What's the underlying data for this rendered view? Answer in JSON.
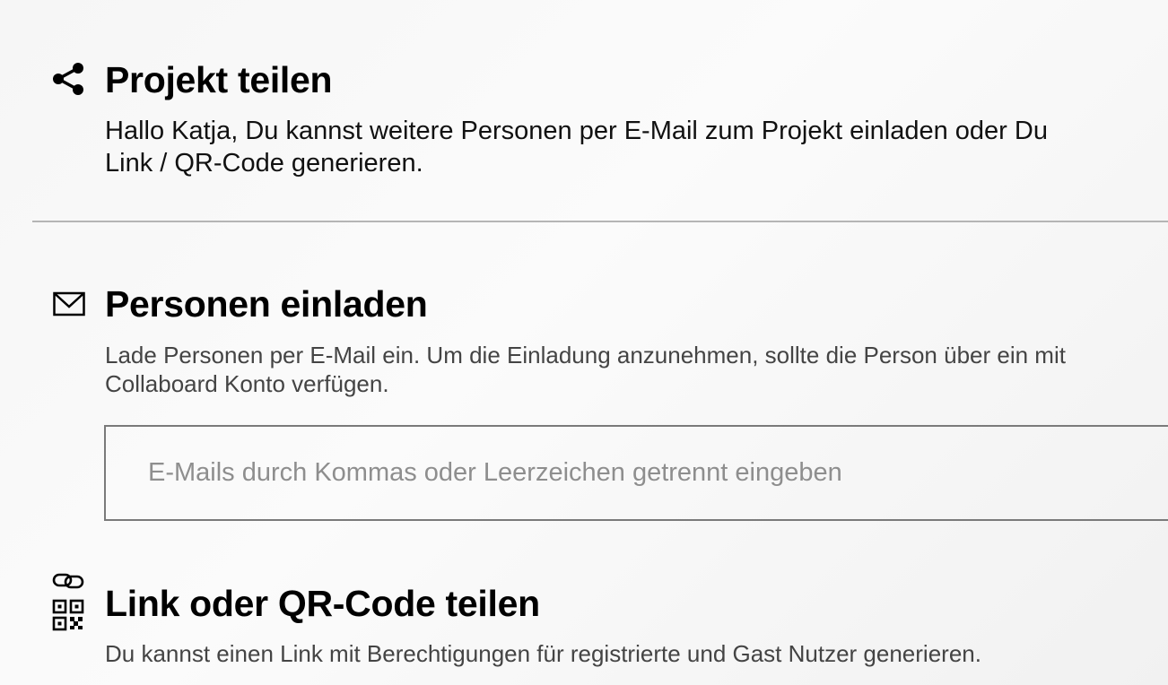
{
  "share": {
    "icon": "share-icon",
    "title": "Projekt teilen",
    "description": "Hallo Katja, Du kannst weitere Personen per E-Mail zum Projekt einladen oder Du\nLink / QR-Code generieren."
  },
  "invite": {
    "icon": "mail-icon",
    "title": "Personen einladen",
    "description": "Lade Personen per E-Mail ein. Um die Einladung anzunehmen, sollte die Person über ein mit\nCollaboard Konto verfügen.",
    "email_input": {
      "value": "",
      "placeholder": "E-Mails durch Kommas oder Leerzeichen getrennt eingeben"
    }
  },
  "link": {
    "icons": [
      "link-icon",
      "qr-code-icon"
    ],
    "title": "Link oder QR-Code teilen",
    "description": "Du kannst einen Link mit Berechtigungen für registrierte und Gast Nutzer generieren."
  },
  "colors": {
    "text": "#000000",
    "secondary_text": "#444444",
    "divider": "#b5b5b5",
    "input_border": "#7a7a7a",
    "placeholder": "#8e8e8e"
  }
}
